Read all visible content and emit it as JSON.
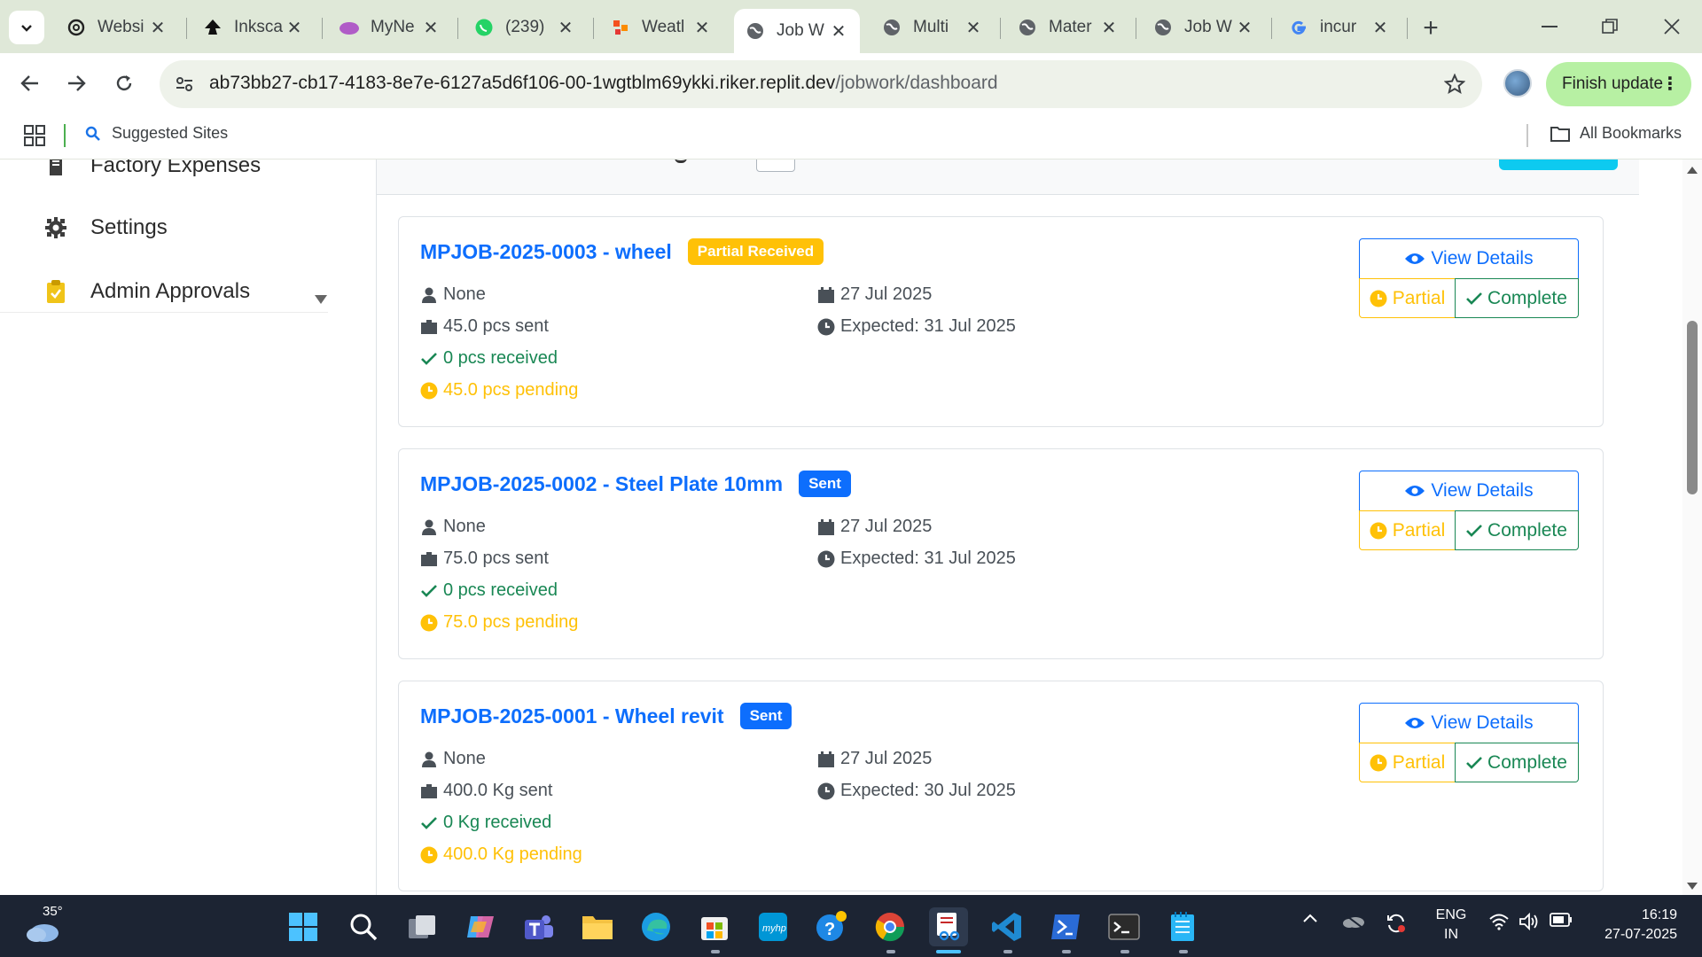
{
  "browser": {
    "tabs": [
      {
        "title": "Websi",
        "icon": "openai-icon"
      },
      {
        "title": "Inksca",
        "icon": "inkscape-icon"
      },
      {
        "title": "MyNe",
        "icon": "purple-cloud-icon"
      },
      {
        "title": "(239)",
        "icon": "whatsapp-icon"
      },
      {
        "title": "Weatl",
        "icon": "weather-app-icon"
      },
      {
        "title": "Job W",
        "icon": "globe-icon",
        "active": true
      },
      {
        "title": "Multi",
        "icon": "globe-icon"
      },
      {
        "title": "Mater",
        "icon": "globe-icon"
      },
      {
        "title": "Job W",
        "icon": "globe-icon"
      },
      {
        "title": "incur",
        "icon": "google-icon"
      }
    ],
    "url_main": "ab73bb27-cb17-4183-8e7e-6127a5d6f106-00-1wgtblm69ykki.riker.replit.dev",
    "url_path": "/jobwork/dashboard",
    "finish_update": "Finish update",
    "bookmarks": {
      "suggested": "Suggested Sites",
      "all": "All Bookmarks"
    }
  },
  "sidebar": {
    "items": [
      {
        "label": "Factory Expenses",
        "icon": "receipt-icon"
      },
      {
        "label": "Settings",
        "icon": "gear-icon"
      },
      {
        "label": "Admin Approvals",
        "icon": "clipboard-check-icon"
      }
    ]
  },
  "jobs": [
    {
      "title": "MPJOB-2025-0003 - wheel",
      "badge": "Partial Received",
      "badge_color": "#ffc107",
      "person": "None",
      "date": "27 Jul 2025",
      "sent": "45.0 pcs sent",
      "expected": "Expected: 31 Jul 2025",
      "received": "0 pcs received",
      "pending": "45.0 pcs pending"
    },
    {
      "title": "MPJOB-2025-0002 - Steel Plate 10mm",
      "badge": "Sent",
      "badge_color": "#0d6efd",
      "person": "None",
      "date": "27 Jul 2025",
      "sent": "75.0 pcs sent",
      "expected": "Expected: 31 Jul 2025",
      "received": "0 pcs received",
      "pending": "75.0 pcs pending"
    },
    {
      "title": "MPJOB-2025-0001 - Wheel revit",
      "badge": "Sent",
      "badge_color": "#0d6efd",
      "person": "None",
      "date": "27 Jul 2025",
      "sent": "400.0 Kg sent",
      "expected": "Expected: 30 Jul 2025",
      "received": "0 Kg received",
      "pending": "400.0 Kg pending"
    }
  ],
  "actions": {
    "view": "View Details",
    "partial": "Partial",
    "complete": "Complete"
  },
  "colors": {
    "primary": "#0d6efd",
    "warning": "#ffc107",
    "success": "#198754"
  },
  "taskbar": {
    "weather_temp": "35°",
    "lang_top": "ENG",
    "lang_bottom": "IN",
    "time": "16:19",
    "date": "27-07-2025"
  }
}
